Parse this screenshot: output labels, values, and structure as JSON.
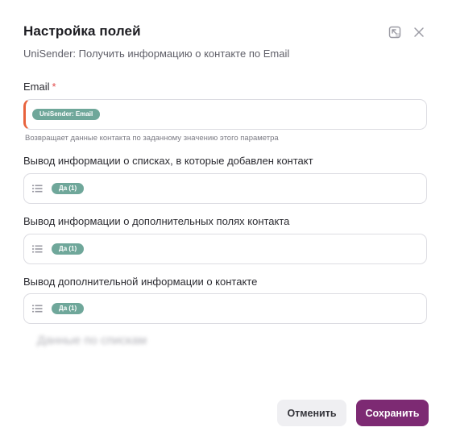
{
  "dialog": {
    "title": "Настройка полей",
    "subtitle": "UniSender: Получить информацию о контакте по Email",
    "icons": [
      "expand-icon",
      "close-icon"
    ]
  },
  "fields": {
    "email": {
      "label": "Email",
      "required_mark": "*",
      "chip": "UniSender: Email",
      "hint": "Возвращает данные контакта по заданному значению этого параметра"
    },
    "lists": {
      "label": "Вывод информации о списках, в которые добавлен контакт",
      "chip": "Да (1)"
    },
    "extra_fields": {
      "label": "Вывод информации о дополнительных полях контакта",
      "chip": "Да (1)"
    },
    "extra_info": {
      "label": "Вывод дополнительной информации о контакте",
      "chip": "Да (1)"
    }
  },
  "blurred_text": "Данные по спискам",
  "buttons": {
    "cancel": "Отменить",
    "save": "Сохранить"
  },
  "colors": {
    "accent": "#7d2a73",
    "chip": "#6fa79a",
    "required": "#e24c4c",
    "email_marker": "#e8623c"
  }
}
